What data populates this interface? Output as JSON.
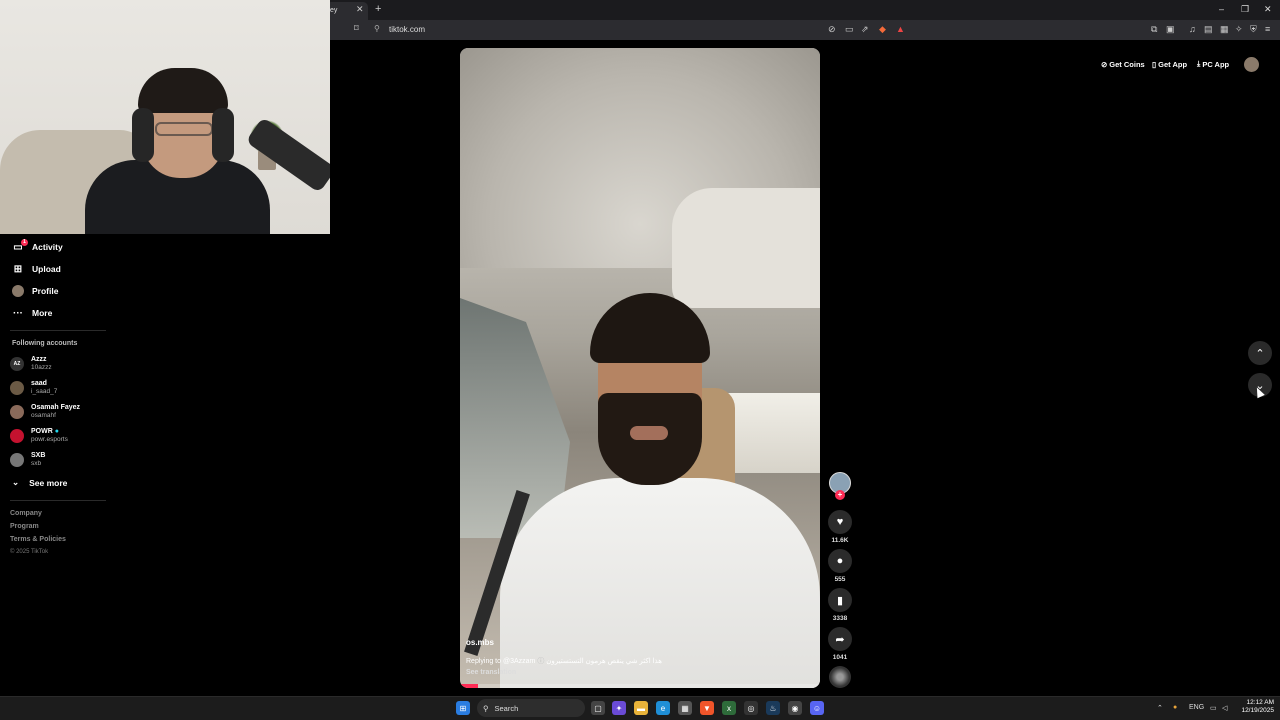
{
  "browser": {
    "tab_title": "ey",
    "url": "tiktok.com",
    "win_min": "–",
    "win_max": "❐",
    "win_close": "✕"
  },
  "sidebar": {
    "items": [
      {
        "label": "Activity",
        "icon": "activity-icon",
        "badge": "1"
      },
      {
        "label": "Upload",
        "icon": "upload-icon"
      },
      {
        "label": "Profile",
        "icon": "profile-icon"
      },
      {
        "label": "More",
        "icon": "more-icon"
      }
    ],
    "following_label": "Following accounts",
    "accounts": [
      {
        "name": "Azzz",
        "handle": "10azzz",
        "avatar": "AZ",
        "color": "#333333"
      },
      {
        "name": "saad",
        "handle": "i_saad_7",
        "avatar": "",
        "color": "#6b5a45"
      },
      {
        "name": "Osamah Fayez",
        "handle": "osamahf",
        "avatar": "",
        "color": "#8a6a5a"
      },
      {
        "name": "POWR",
        "handle": "powr.esports",
        "avatar": "",
        "color": "#c4122f",
        "verified": true
      },
      {
        "name": "SXB",
        "handle": "sxb",
        "avatar": "",
        "color": "#777777"
      }
    ],
    "see_more": "See more",
    "footer": [
      "Company",
      "Program",
      "Terms & Policies"
    ],
    "copyright": "© 2025 TikTok"
  },
  "video": {
    "username": "os.mbs",
    "reply": "Replying to @3Azzam",
    "caption": "هذا اكثر شي ينقص هرمون التستستيرون",
    "see_translation": "See translation",
    "progress": 0.05
  },
  "actions": {
    "likes": "11.6K",
    "comments": "555",
    "saves": "3338",
    "shares": "1041"
  },
  "top_actions": {
    "get_coins": "Get Coins",
    "get_app": "Get App",
    "pc_app": "PC App"
  },
  "taskbar": {
    "search_placeholder": "Search",
    "lang": "ENG",
    "time": "12:12 AM",
    "date": "12/19/2025"
  },
  "colors": {
    "accent": "#fe2c55",
    "background": "#000000"
  }
}
